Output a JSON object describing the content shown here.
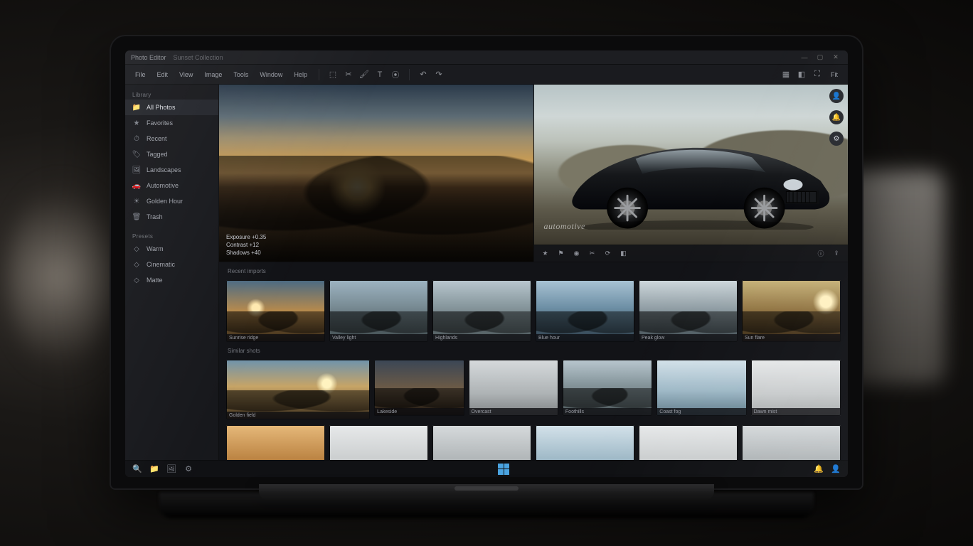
{
  "titlebar": {
    "appName": "Photo Editor",
    "document": "Sunset Collection"
  },
  "menu": {
    "items": [
      "File",
      "Edit",
      "View",
      "Image",
      "Tools",
      "Window",
      "Help"
    ]
  },
  "toolbar": {
    "left": [
      "select",
      "crop",
      "brush",
      "text",
      "eyedrop"
    ],
    "mid": [
      "undo",
      "redo"
    ],
    "view": [
      "grid",
      "compare",
      "fullscreen"
    ],
    "zoom": "Fit"
  },
  "sidebar": {
    "sectionA": "Library",
    "items": [
      {
        "icon": "folder",
        "label": "All Photos"
      },
      {
        "icon": "star",
        "label": "Favorites"
      },
      {
        "icon": "clock",
        "label": "Recent"
      },
      {
        "icon": "tag",
        "label": "Tagged"
      },
      {
        "icon": "image",
        "label": "Landscapes"
      },
      {
        "icon": "car",
        "label": "Automotive"
      },
      {
        "icon": "sun",
        "label": "Golden Hour"
      },
      {
        "icon": "trash",
        "label": "Trash"
      }
    ],
    "sectionB": "Presets",
    "presets": [
      "Warm",
      "Cinematic",
      "Matte"
    ]
  },
  "preview": {
    "left": {
      "info": [
        "Exposure  +0.35",
        "Contrast  +12",
        "Shadows  +40"
      ]
    },
    "right": {
      "watermark": "automotive"
    },
    "miniToolbar": [
      "rate",
      "flag",
      "color",
      "crop",
      "rotate",
      "compare",
      "info",
      "export"
    ]
  },
  "grid": {
    "labelA": "Recent imports",
    "labelB": "Similar shots",
    "rowA": [
      "Sunrise ridge",
      "Valley light",
      "Highlands",
      "Blue hour",
      "Peak glow",
      "Sun flare"
    ],
    "rowB": [
      "Golden field",
      "Lakeside",
      "Overcast",
      "Foothills",
      "Coast fog",
      "Dawn mist"
    ],
    "rowC": [
      "",
      "",
      "",
      "",
      "",
      ""
    ]
  },
  "taskbar": {
    "brand": ""
  },
  "icons": {
    "select": "⬚",
    "crop": "✂",
    "brush": "🖌",
    "text": "T",
    "eyedrop": "⦿",
    "undo": "↶",
    "redo": "↷",
    "grid": "▦",
    "compare": "◧",
    "fullscreen": "⛶",
    "folder": "📁",
    "star": "★",
    "clock": "⏱",
    "tag": "🏷",
    "image": "🖼",
    "car": "🚗",
    "sun": "☀",
    "trash": "🗑",
    "rate": "★",
    "flag": "⚑",
    "color": "◉",
    "rotate": "⟳",
    "info": "ⓘ",
    "export": "⇪",
    "search": "🔍",
    "settings": "⚙",
    "bell": "🔔",
    "user": "👤"
  }
}
